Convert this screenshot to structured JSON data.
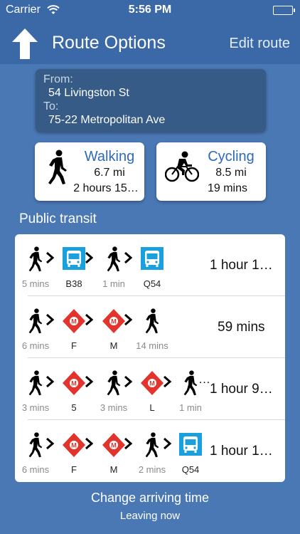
{
  "status_bar": {
    "carrier": "Carrier",
    "time": "5:56 PM"
  },
  "nav": {
    "title": "Route Options",
    "edit_label": "Edit route",
    "back_icon": "up-arrow-icon"
  },
  "route": {
    "from_label": "From:",
    "from_value": "54 Livingston St",
    "to_label": "To:",
    "to_value": "75-22 Metropolitan Ave"
  },
  "modes": {
    "walking": {
      "name": "Walking",
      "distance": "6.7 mi",
      "duration": "2 hours 15…"
    },
    "cycling": {
      "name": "Cycling",
      "distance": "8.5 mi",
      "duration": "19 mins"
    }
  },
  "transit": {
    "section_title": "Public transit",
    "routes": [
      {
        "total": "1 hour 1…",
        "steps": [
          {
            "type": "walk",
            "label": "5 mins"
          },
          {
            "type": "bus",
            "label": "B38"
          },
          {
            "type": "walk",
            "label": "1 min"
          },
          {
            "type": "bus",
            "label": "Q54"
          }
        ]
      },
      {
        "total": "59 mins",
        "steps": [
          {
            "type": "walk",
            "label": "6 mins"
          },
          {
            "type": "metro",
            "label": "F"
          },
          {
            "type": "metro",
            "label": "M"
          },
          {
            "type": "walk",
            "label": "14 mins"
          }
        ]
      },
      {
        "total": "1 hour 9…",
        "overflow": "…",
        "steps": [
          {
            "type": "walk",
            "label": "3 mins"
          },
          {
            "type": "metro",
            "label": "5"
          },
          {
            "type": "walk",
            "label": "3 mins"
          },
          {
            "type": "metro",
            "label": "L"
          },
          {
            "type": "walk",
            "label": "1 min"
          }
        ]
      },
      {
        "total": "1 hour 1…",
        "steps": [
          {
            "type": "walk",
            "label": "6 mins"
          },
          {
            "type": "metro",
            "label": "F"
          },
          {
            "type": "metro",
            "label": "M"
          },
          {
            "type": "walk",
            "label": "2 mins"
          },
          {
            "type": "bus",
            "label": "Q54"
          }
        ]
      }
    ]
  },
  "footer": {
    "change_time_label": "Change arriving time",
    "leaving_label": "Leaving now"
  },
  "colors": {
    "background": "#4a78b4",
    "bar": "#3b69a8",
    "bus": "#1aa0dc",
    "metro": "#e2342c",
    "link": "#2e6ab7"
  }
}
